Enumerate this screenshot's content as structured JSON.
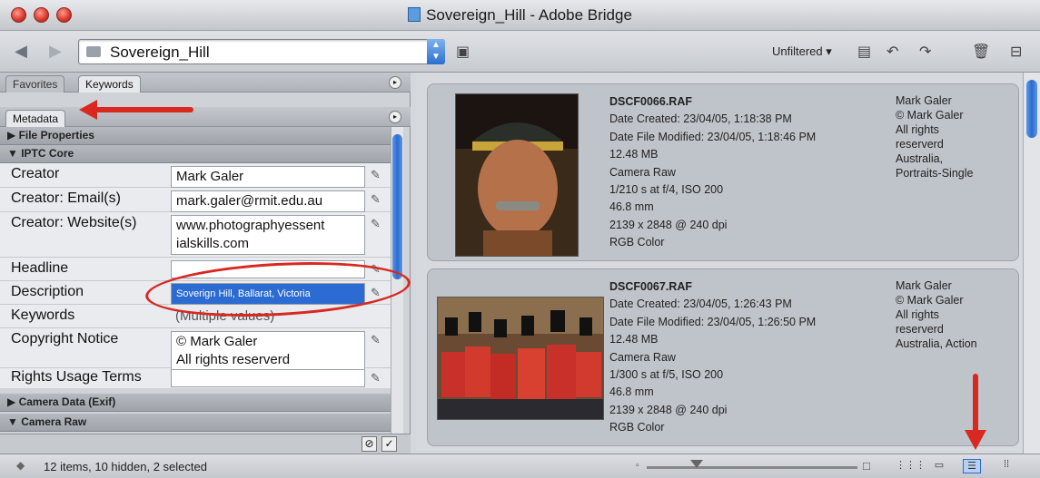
{
  "window": {
    "title": "Sovereign_Hill - Adobe Bridge"
  },
  "toolbar": {
    "path": "Sovereign_Hill",
    "filter": "Unfiltered"
  },
  "left_panel": {
    "tabs_top": [
      "Favorites",
      "Keywords"
    ],
    "tab_metadata": "Metadata",
    "sections": {
      "file_properties": "File Properties",
      "iptc_core": "IPTC Core",
      "camera_data": "Camera Data (Exif)",
      "camera_raw": "Camera Raw"
    },
    "fields": [
      {
        "label": "Creator",
        "value": "Mark Galer"
      },
      {
        "label": "Creator: Email(s)",
        "value": "mark.galer@rmit.edu.au"
      },
      {
        "label": "Creator: Website(s)",
        "value": "www.photographyessent",
        "value2": "ialskills.com"
      },
      {
        "label": "Headline",
        "value": ""
      },
      {
        "label": "Description",
        "value": "Soverign Hill, Ballarat, Victoria"
      },
      {
        "label": "Keywords",
        "value": "(Multiple values)"
      },
      {
        "label": "Copyright Notice",
        "value": "© Mark Galer",
        "value2": "All rights reserverd"
      },
      {
        "label": "Rights Usage Terms",
        "value": ""
      }
    ]
  },
  "files": [
    {
      "name": "DSCF0066.RAF",
      "date_created": "Date Created: 23/04/05, 1:18:38 PM",
      "date_modified": "Date File Modified: 23/04/05, 1:18:46 PM",
      "size": "12.48 MB",
      "format": "Camera Raw",
      "exposure": "1/210 s at f/4, ISO 200",
      "focal": "46.8 mm",
      "dimensions": "2139 x 2848 @ 240 dpi",
      "color": "RGB Color",
      "creator": "Mark Galer",
      "copyright": "© Mark Galer",
      "rights1": "All rights",
      "rights2": "reserverd",
      "keywords1": "Australia,",
      "keywords2": "Portraits-Single"
    },
    {
      "name": "DSCF0067.RAF",
      "date_created": "Date Created: 23/04/05, 1:26:43 PM",
      "date_modified": "Date File Modified: 23/04/05, 1:26:50 PM",
      "size": "12.48 MB",
      "format": "Camera Raw",
      "exposure": "1/300 s at f/5, ISO 200",
      "focal": "46.8 mm",
      "dimensions": "2139 x 2848 @ 240 dpi",
      "color": "RGB Color",
      "creator": "Mark Galer",
      "copyright": "© Mark Galer",
      "rights1": "All rights",
      "rights2": "reserverd",
      "keywords1": "Australia, Action",
      "keywords2": ""
    }
  ],
  "status": {
    "text": "12 items, 10 hidden, 2 selected"
  },
  "colors": {
    "annotation_red": "#d82820",
    "selection_blue": "#2c6bd1"
  }
}
